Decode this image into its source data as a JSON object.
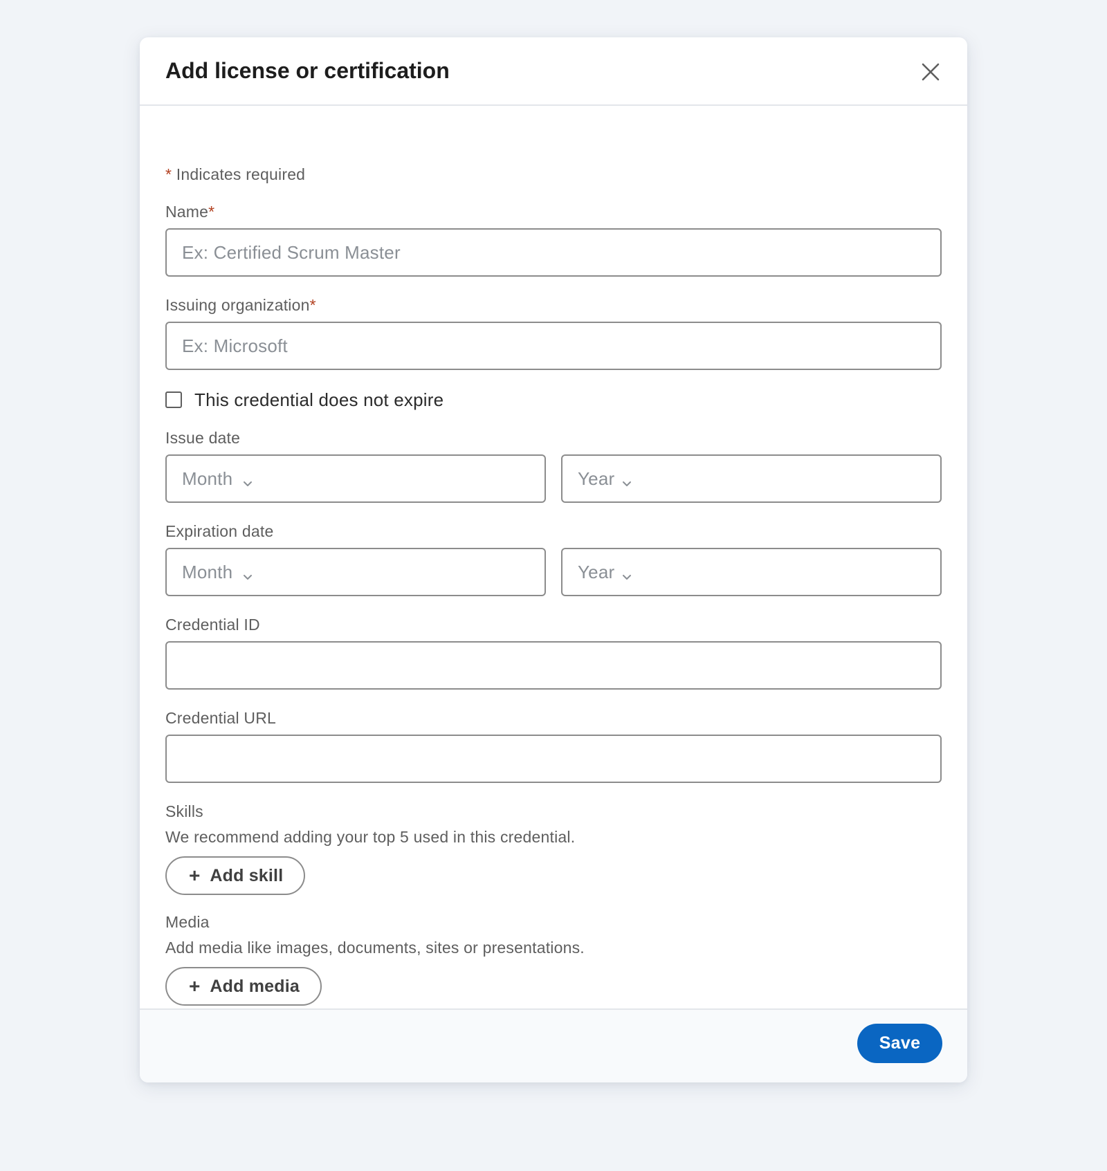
{
  "dialog": {
    "title": "Add license or certification",
    "close_icon": "close-icon"
  },
  "required_note": {
    "star": "*",
    "text": " Indicates required"
  },
  "fields": {
    "name": {
      "label": "Name",
      "required_star": "*",
      "value": "",
      "placeholder": "Ex: Certified Scrum Master"
    },
    "issuing_org": {
      "label": "Issuing organization",
      "required_star": "*",
      "value": "",
      "placeholder": "Ex: Microsoft"
    },
    "no_expire": {
      "label": "This credential does not expire",
      "checked": false
    },
    "issue_date": {
      "label": "Issue date",
      "month": "Month",
      "year": "Year",
      "chevron_icon": "chevron-down-icon"
    },
    "expiration_date": {
      "label": "Expiration date",
      "month": "Month",
      "year": "Year",
      "chevron_icon": "chevron-down-icon"
    },
    "credential_id": {
      "label": "Credential ID",
      "value": "",
      "placeholder": ""
    },
    "credential_url": {
      "label": "Credential URL",
      "value": "",
      "placeholder": ""
    }
  },
  "skills": {
    "label": "Skills",
    "helper": "We recommend adding your top 5 used in this credential.",
    "button_plus": "+",
    "button_label": "Add skill"
  },
  "media": {
    "label": "Media",
    "helper": "Add media like images, documents, sites or presentations.",
    "button_plus": "+",
    "button_label": "Add media"
  },
  "footer": {
    "save_label": "Save"
  },
  "colors": {
    "page_bg": "#f1f4f8",
    "primary": "#0a66c2",
    "required_star": "#b24020",
    "border": "#8c8c8c"
  }
}
